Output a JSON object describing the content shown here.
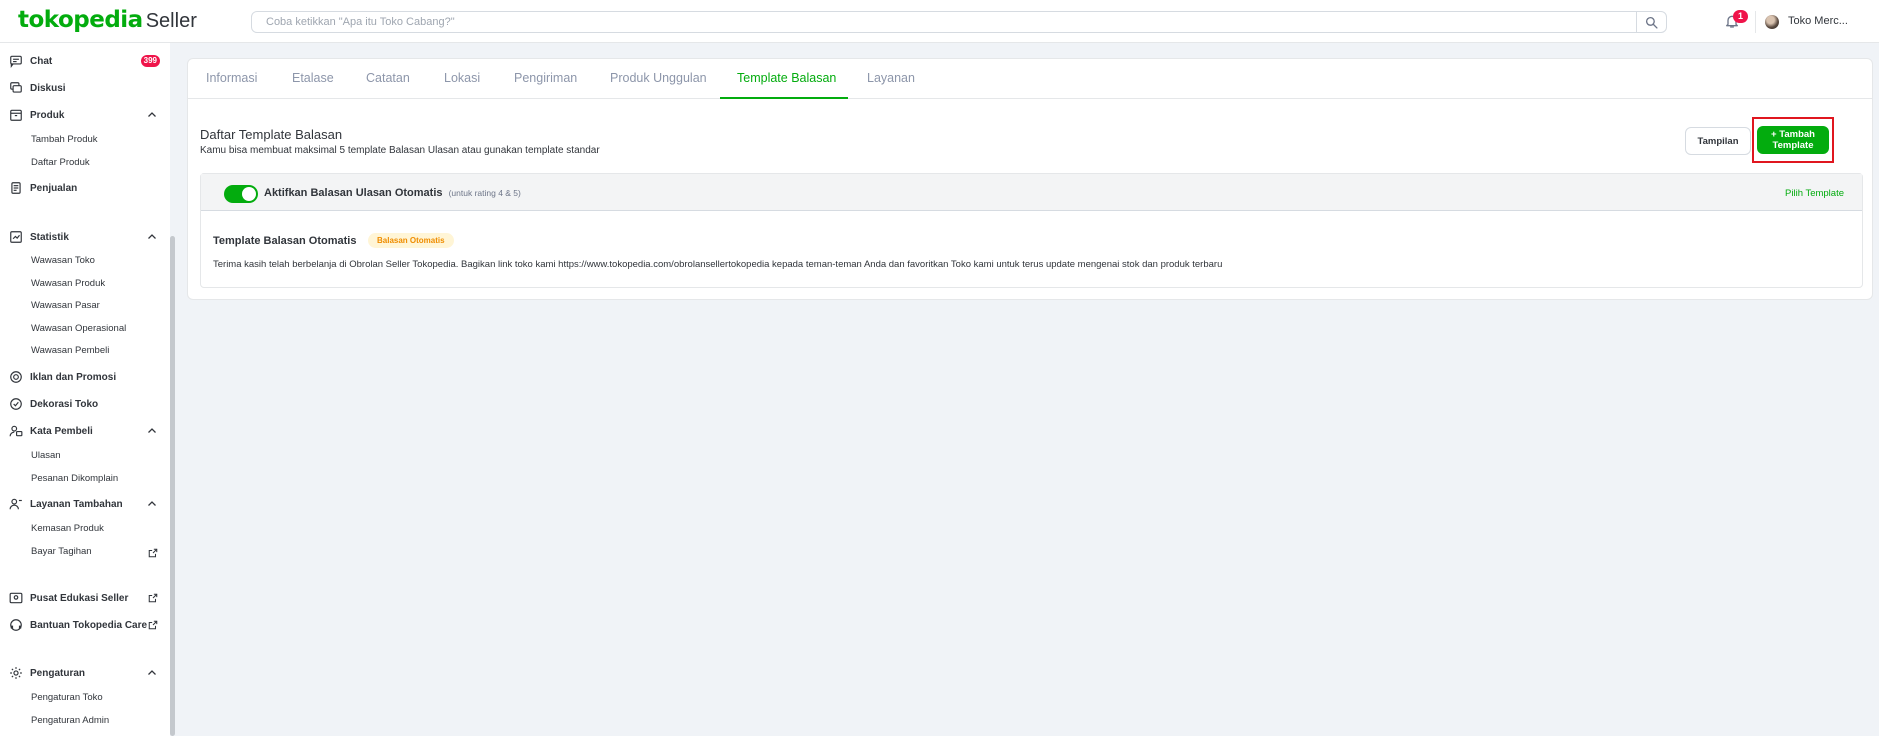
{
  "header": {
    "logo_main": "tokopedia",
    "logo_sub": "Seller",
    "search_placeholder": "Coba ketikkan \"Apa itu Toko Cabang?\"",
    "notification_count": "1",
    "shop_name": "Toko Merc..."
  },
  "sidebar": {
    "chat": {
      "label": "Chat",
      "badge": "399"
    },
    "diskusi": "Diskusi",
    "produk": {
      "label": "Produk",
      "items": [
        "Tambah Produk",
        "Daftar Produk"
      ]
    },
    "penjualan": "Penjualan",
    "statistik": {
      "label": "Statistik",
      "items": [
        "Wawasan Toko",
        "Wawasan Produk",
        "Wawasan Pasar",
        "Wawasan Operasional",
        "Wawasan Pembeli"
      ]
    },
    "iklan": "Iklan dan Promosi",
    "dekorasi": "Dekorasi Toko",
    "kata_pembeli": {
      "label": "Kata Pembeli",
      "items": [
        "Ulasan",
        "Pesanan Dikomplain"
      ]
    },
    "layanan_tambahan": {
      "label": "Layanan Tambahan",
      "items": [
        "Kemasan Produk",
        "Bayar Tagihan"
      ]
    },
    "pusat_edukasi": "Pusat Edukasi Seller",
    "bantuan": "Bantuan Tokopedia Care",
    "pengaturan": {
      "label": "Pengaturan",
      "items": [
        "Pengaturan Toko",
        "Pengaturan Admin"
      ]
    }
  },
  "tabs": [
    "Informasi",
    "Etalase",
    "Catatan",
    "Lokasi",
    "Pengiriman",
    "Produk Unggulan",
    "Template Balasan",
    "Layanan"
  ],
  "active_tab": "Template Balasan",
  "section": {
    "title": "Daftar Template Balasan",
    "description": "Kamu bisa membuat maksimal 5 template Balasan Ulasan atau gunakan template standar",
    "btn_tampilan": "Tampilan",
    "btn_tambah": "+ Tambah Template"
  },
  "auto_reply": {
    "enabled": true,
    "title": "Aktifkan Balasan Ulasan Otomatis",
    "note": "(untuk rating 4 & 5)",
    "pilih_template": "Pilih Template",
    "template_name": "Template Balasan Otomatis",
    "template_badge": "Balasan Otomatis",
    "template_text": "Terima kasih telah berbelanja di Obrolan Seller Tokopedia. Bagikan link toko kami https://www.tokopedia.com/obrolansellertokopedia kepada teman-teman Anda dan favoritkan Toko kami untuk terus update mengenai stok dan produk terbaru"
  },
  "colors": {
    "brand_green": "#03ac0e",
    "badge_red": "#ef144a",
    "highlight_red": "#e0161f",
    "badge_yellow_bg": "#fff5d6",
    "badge_yellow_text": "#ef8d00"
  }
}
